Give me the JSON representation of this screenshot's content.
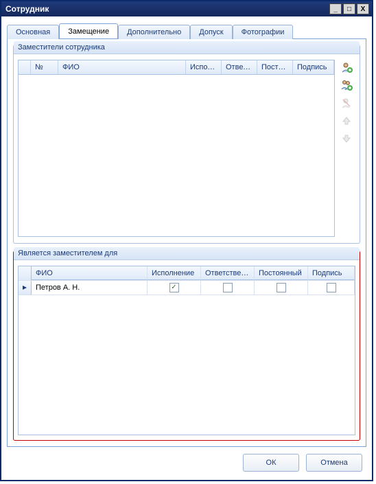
{
  "window": {
    "title": "Сотрудник",
    "minimize_label": "_",
    "maximize_label": "□",
    "close_label": "X"
  },
  "tabs": [
    {
      "label": "Основная"
    },
    {
      "label": "Замещение"
    },
    {
      "label": "Дополнительно"
    },
    {
      "label": "Допуск"
    },
    {
      "label": "Фотографии"
    }
  ],
  "active_tab_index": 1,
  "panel_top": {
    "caption": "Заместители сотрудника",
    "columns": {
      "rownum": "№",
      "fio": "ФИО",
      "ispol": "Испол…",
      "otvet": "Ответ…",
      "posto": "Посто…",
      "podpis": "Подпись"
    },
    "rows": []
  },
  "toolbar": {
    "add_user": "add-user-icon",
    "add_users": "add-users-icon",
    "remove_user": "remove-user-icon",
    "move_up": "arrow-up-icon",
    "move_down": "arrow-down-icon"
  },
  "panel_bottom": {
    "caption": "Является заместителем для",
    "columns": {
      "fio": "ФИО",
      "ispol": "Исполнение",
      "otvet": "Ответстве…",
      "posto": "Постоянный",
      "podpis": "Подпись"
    },
    "rows": [
      {
        "fio": "Петров А. Н.",
        "ispol": true,
        "otvet": false,
        "posto": false,
        "podpis": false
      }
    ]
  },
  "buttons": {
    "ok": "ОК",
    "cancel": "Отмена"
  }
}
